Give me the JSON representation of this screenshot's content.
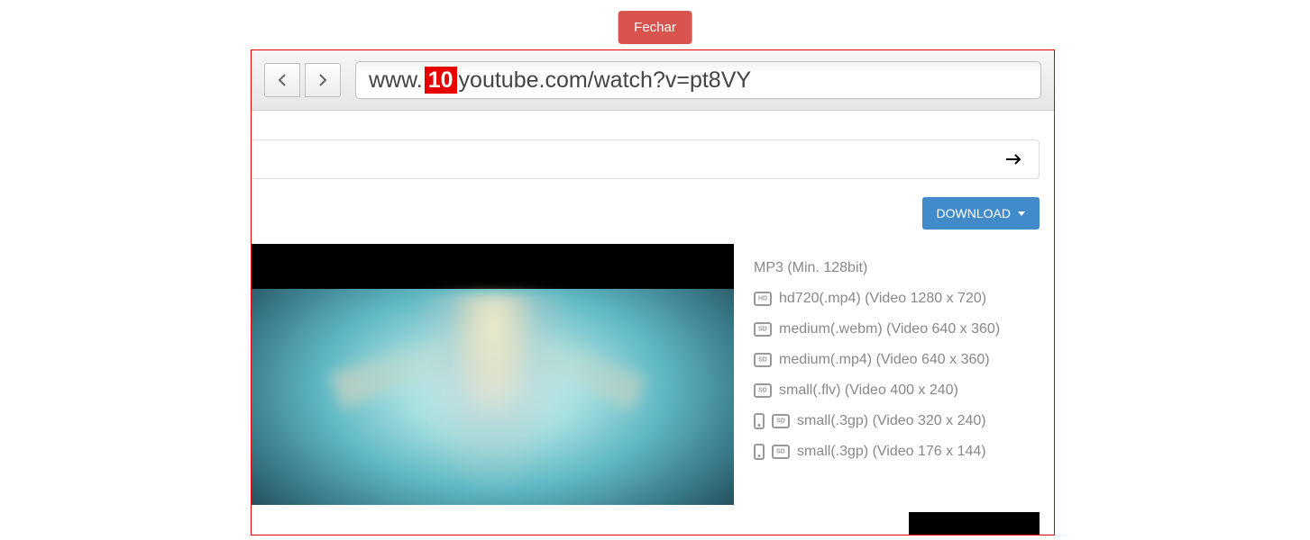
{
  "close_button": "Fechar",
  "url": {
    "prefix": "www.",
    "badge": "10",
    "suffix": "youtube.com/watch?v=pt8VY"
  },
  "download_button": "DOWNLOAD",
  "formats": {
    "header": "MP3 (Min. 128bit)",
    "items": [
      {
        "phone": false,
        "badge": "HD",
        "label": "hd720(.mp4) (Video 1280 x 720)"
      },
      {
        "phone": false,
        "badge": "SD",
        "label": "medium(.webm) (Video 640 x 360)"
      },
      {
        "phone": false,
        "badge": "SD",
        "label": "medium(.mp4) (Video 640 x 360)"
      },
      {
        "phone": false,
        "badge": "SD",
        "label": "small(.flv) (Video 400 x 240)"
      },
      {
        "phone": true,
        "badge": "SD",
        "label": "small(.3gp) (Video 320 x 240)"
      },
      {
        "phone": true,
        "badge": "SD",
        "label": "small(.3gp) (Video 176 x 144)"
      }
    ]
  }
}
